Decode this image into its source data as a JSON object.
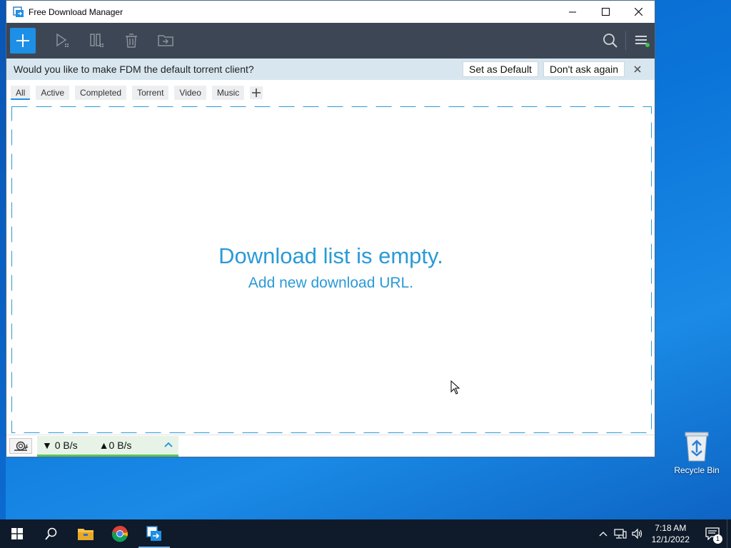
{
  "window": {
    "title": "Free Download Manager"
  },
  "banner": {
    "message": "Would you like to make FDM the default torrent client?",
    "set_default_label": "Set as Default",
    "dont_ask_label": "Don't ask again"
  },
  "filters": {
    "items": [
      "All",
      "Active",
      "Completed",
      "Torrent",
      "Video",
      "Music"
    ],
    "selected": "All"
  },
  "main": {
    "empty_title": "Download list is empty.",
    "empty_subtitle": "Add new download URL."
  },
  "status": {
    "download_speed": "0 B/s",
    "upload_speed": "0 B/s"
  },
  "desktop": {
    "recycle_bin_label": "Recycle Bin"
  },
  "taskbar": {
    "time": "7:18 AM",
    "date": "12/1/2022",
    "notification_count": "1"
  },
  "colors": {
    "accent": "#1e8fe6",
    "toolbar_bg": "#3d4654",
    "banner_bg": "#d8e6ef",
    "empty_text": "#2a9ad8",
    "speed_bar": "#5cc45c"
  },
  "icons": {
    "toolbar": [
      "plus-icon",
      "play-icon",
      "pause-icon",
      "trash-icon",
      "move-folder-icon",
      "search-icon",
      "menu-icon"
    ],
    "taskbar": [
      "windows-start-icon",
      "search-icon",
      "file-explorer-icon",
      "chrome-icon",
      "fdm-icon"
    ]
  }
}
